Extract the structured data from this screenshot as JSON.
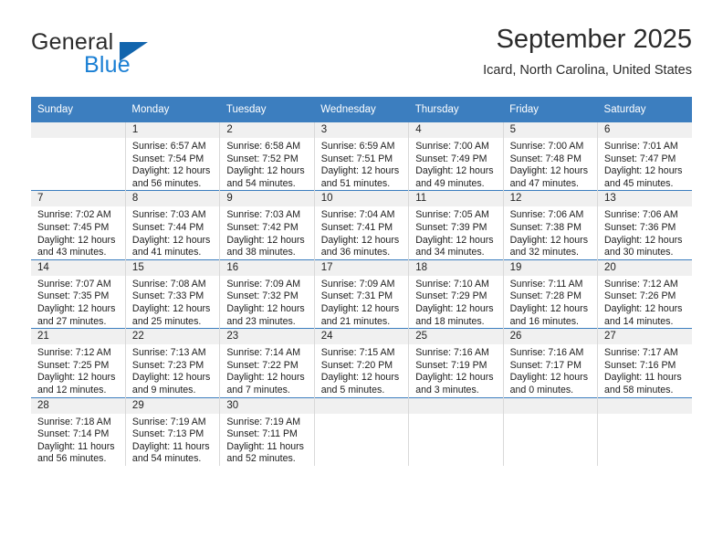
{
  "brand": {
    "name_part1": "General",
    "name_part2": "Blue"
  },
  "header": {
    "title": "September 2025",
    "location": "Icard, North Carolina, United States"
  },
  "calendar": {
    "weekday_headers": [
      "Sunday",
      "Monday",
      "Tuesday",
      "Wednesday",
      "Thursday",
      "Friday",
      "Saturday"
    ],
    "colors": {
      "header_bg": "#3c7ebf",
      "daynum_bg": "#f0f0f0",
      "row_border": "#3c7ebf",
      "cell_border": "#d9d9d9",
      "brand_blue": "#1a7fd4"
    },
    "weeks": [
      [
        {
          "day": "",
          "sunrise": "",
          "sunset": "",
          "daylight_line1": "",
          "daylight_line2": ""
        },
        {
          "day": "1",
          "sunrise": "Sunrise: 6:57 AM",
          "sunset": "Sunset: 7:54 PM",
          "daylight_line1": "Daylight: 12 hours",
          "daylight_line2": "and 56 minutes."
        },
        {
          "day": "2",
          "sunrise": "Sunrise: 6:58 AM",
          "sunset": "Sunset: 7:52 PM",
          "daylight_line1": "Daylight: 12 hours",
          "daylight_line2": "and 54 minutes."
        },
        {
          "day": "3",
          "sunrise": "Sunrise: 6:59 AM",
          "sunset": "Sunset: 7:51 PM",
          "daylight_line1": "Daylight: 12 hours",
          "daylight_line2": "and 51 minutes."
        },
        {
          "day": "4",
          "sunrise": "Sunrise: 7:00 AM",
          "sunset": "Sunset: 7:49 PM",
          "daylight_line1": "Daylight: 12 hours",
          "daylight_line2": "and 49 minutes."
        },
        {
          "day": "5",
          "sunrise": "Sunrise: 7:00 AM",
          "sunset": "Sunset: 7:48 PM",
          "daylight_line1": "Daylight: 12 hours",
          "daylight_line2": "and 47 minutes."
        },
        {
          "day": "6",
          "sunrise": "Sunrise: 7:01 AM",
          "sunset": "Sunset: 7:47 PM",
          "daylight_line1": "Daylight: 12 hours",
          "daylight_line2": "and 45 minutes."
        }
      ],
      [
        {
          "day": "7",
          "sunrise": "Sunrise: 7:02 AM",
          "sunset": "Sunset: 7:45 PM",
          "daylight_line1": "Daylight: 12 hours",
          "daylight_line2": "and 43 minutes."
        },
        {
          "day": "8",
          "sunrise": "Sunrise: 7:03 AM",
          "sunset": "Sunset: 7:44 PM",
          "daylight_line1": "Daylight: 12 hours",
          "daylight_line2": "and 41 minutes."
        },
        {
          "day": "9",
          "sunrise": "Sunrise: 7:03 AM",
          "sunset": "Sunset: 7:42 PM",
          "daylight_line1": "Daylight: 12 hours",
          "daylight_line2": "and 38 minutes."
        },
        {
          "day": "10",
          "sunrise": "Sunrise: 7:04 AM",
          "sunset": "Sunset: 7:41 PM",
          "daylight_line1": "Daylight: 12 hours",
          "daylight_line2": "and 36 minutes."
        },
        {
          "day": "11",
          "sunrise": "Sunrise: 7:05 AM",
          "sunset": "Sunset: 7:39 PM",
          "daylight_line1": "Daylight: 12 hours",
          "daylight_line2": "and 34 minutes."
        },
        {
          "day": "12",
          "sunrise": "Sunrise: 7:06 AM",
          "sunset": "Sunset: 7:38 PM",
          "daylight_line1": "Daylight: 12 hours",
          "daylight_line2": "and 32 minutes."
        },
        {
          "day": "13",
          "sunrise": "Sunrise: 7:06 AM",
          "sunset": "Sunset: 7:36 PM",
          "daylight_line1": "Daylight: 12 hours",
          "daylight_line2": "and 30 minutes."
        }
      ],
      [
        {
          "day": "14",
          "sunrise": "Sunrise: 7:07 AM",
          "sunset": "Sunset: 7:35 PM",
          "daylight_line1": "Daylight: 12 hours",
          "daylight_line2": "and 27 minutes."
        },
        {
          "day": "15",
          "sunrise": "Sunrise: 7:08 AM",
          "sunset": "Sunset: 7:33 PM",
          "daylight_line1": "Daylight: 12 hours",
          "daylight_line2": "and 25 minutes."
        },
        {
          "day": "16",
          "sunrise": "Sunrise: 7:09 AM",
          "sunset": "Sunset: 7:32 PM",
          "daylight_line1": "Daylight: 12 hours",
          "daylight_line2": "and 23 minutes."
        },
        {
          "day": "17",
          "sunrise": "Sunrise: 7:09 AM",
          "sunset": "Sunset: 7:31 PM",
          "daylight_line1": "Daylight: 12 hours",
          "daylight_line2": "and 21 minutes."
        },
        {
          "day": "18",
          "sunrise": "Sunrise: 7:10 AM",
          "sunset": "Sunset: 7:29 PM",
          "daylight_line1": "Daylight: 12 hours",
          "daylight_line2": "and 18 minutes."
        },
        {
          "day": "19",
          "sunrise": "Sunrise: 7:11 AM",
          "sunset": "Sunset: 7:28 PM",
          "daylight_line1": "Daylight: 12 hours",
          "daylight_line2": "and 16 minutes."
        },
        {
          "day": "20",
          "sunrise": "Sunrise: 7:12 AM",
          "sunset": "Sunset: 7:26 PM",
          "daylight_line1": "Daylight: 12 hours",
          "daylight_line2": "and 14 minutes."
        }
      ],
      [
        {
          "day": "21",
          "sunrise": "Sunrise: 7:12 AM",
          "sunset": "Sunset: 7:25 PM",
          "daylight_line1": "Daylight: 12 hours",
          "daylight_line2": "and 12 minutes."
        },
        {
          "day": "22",
          "sunrise": "Sunrise: 7:13 AM",
          "sunset": "Sunset: 7:23 PM",
          "daylight_line1": "Daylight: 12 hours",
          "daylight_line2": "and 9 minutes."
        },
        {
          "day": "23",
          "sunrise": "Sunrise: 7:14 AM",
          "sunset": "Sunset: 7:22 PM",
          "daylight_line1": "Daylight: 12 hours",
          "daylight_line2": "and 7 minutes."
        },
        {
          "day": "24",
          "sunrise": "Sunrise: 7:15 AM",
          "sunset": "Sunset: 7:20 PM",
          "daylight_line1": "Daylight: 12 hours",
          "daylight_line2": "and 5 minutes."
        },
        {
          "day": "25",
          "sunrise": "Sunrise: 7:16 AM",
          "sunset": "Sunset: 7:19 PM",
          "daylight_line1": "Daylight: 12 hours",
          "daylight_line2": "and 3 minutes."
        },
        {
          "day": "26",
          "sunrise": "Sunrise: 7:16 AM",
          "sunset": "Sunset: 7:17 PM",
          "daylight_line1": "Daylight: 12 hours",
          "daylight_line2": "and 0 minutes."
        },
        {
          "day": "27",
          "sunrise": "Sunrise: 7:17 AM",
          "sunset": "Sunset: 7:16 PM",
          "daylight_line1": "Daylight: 11 hours",
          "daylight_line2": "and 58 minutes."
        }
      ],
      [
        {
          "day": "28",
          "sunrise": "Sunrise: 7:18 AM",
          "sunset": "Sunset: 7:14 PM",
          "daylight_line1": "Daylight: 11 hours",
          "daylight_line2": "and 56 minutes."
        },
        {
          "day": "29",
          "sunrise": "Sunrise: 7:19 AM",
          "sunset": "Sunset: 7:13 PM",
          "daylight_line1": "Daylight: 11 hours",
          "daylight_line2": "and 54 minutes."
        },
        {
          "day": "30",
          "sunrise": "Sunrise: 7:19 AM",
          "sunset": "Sunset: 7:11 PM",
          "daylight_line1": "Daylight: 11 hours",
          "daylight_line2": "and 52 minutes."
        },
        {
          "day": "",
          "sunrise": "",
          "sunset": "",
          "daylight_line1": "",
          "daylight_line2": ""
        },
        {
          "day": "",
          "sunrise": "",
          "sunset": "",
          "daylight_line1": "",
          "daylight_line2": ""
        },
        {
          "day": "",
          "sunrise": "",
          "sunset": "",
          "daylight_line1": "",
          "daylight_line2": ""
        },
        {
          "day": "",
          "sunrise": "",
          "sunset": "",
          "daylight_line1": "",
          "daylight_line2": ""
        }
      ]
    ]
  }
}
